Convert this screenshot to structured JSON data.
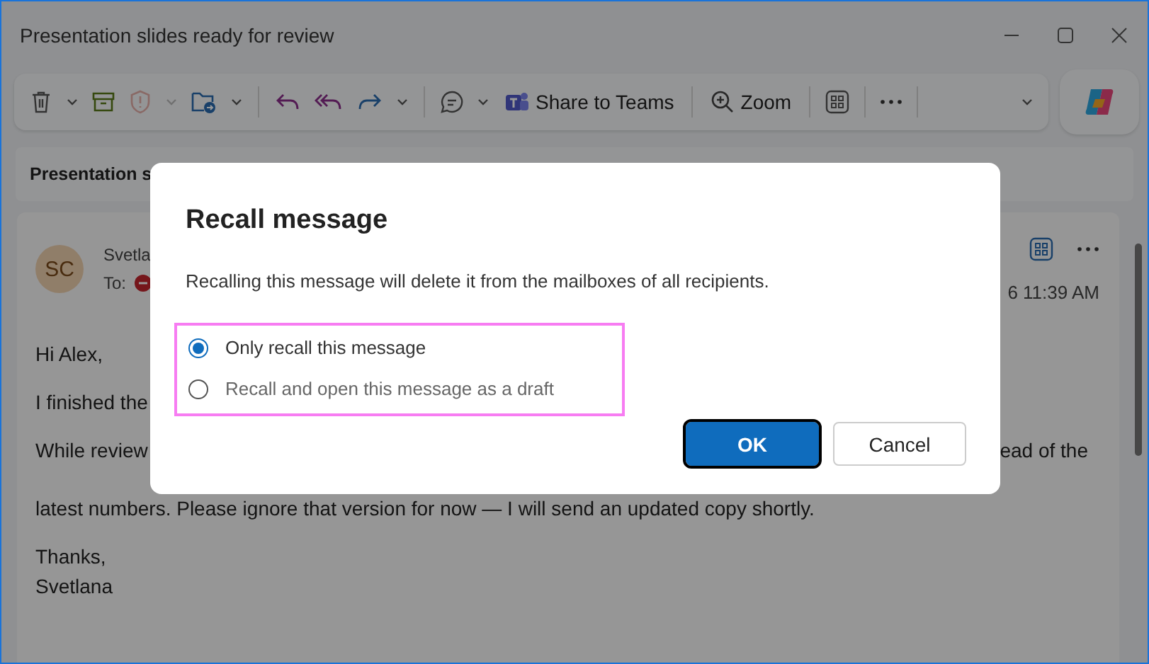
{
  "window": {
    "title": "Presentation slides ready for review"
  },
  "toolbar": {
    "report_disabled": true,
    "buttons": [
      {
        "label": "Share to Teams"
      },
      {
        "label": "Zoom"
      }
    ]
  },
  "subject": "Presentation s",
  "message": {
    "avatar": "SC",
    "sender": "Svetla",
    "to_label": "To:",
    "time": "6 11:39 AM",
    "body": [
      {
        "lines": [
          {
            "left": "Hi Alex,"
          }
        ]
      },
      {
        "lines": [
          {
            "left": "I finished the"
          }
        ]
      },
      {
        "lines": [
          {
            "left": "While review",
            "right": "ead of the"
          },
          {
            "left": "latest numbers. Please ignore that version for now — I will send an updated copy shortly."
          }
        ]
      },
      {
        "lines": [
          {
            "left": "Thanks,"
          },
          {
            "left": "Svetlana"
          }
        ]
      }
    ]
  },
  "dialog": {
    "title": "Recall message",
    "text": "Recalling this message will delete it from the mailboxes of all recipients.",
    "options": [
      {
        "label": "Only recall this message",
        "selected": true
      },
      {
        "label": "Recall and open this message as a draft",
        "selected": false
      }
    ],
    "buttons": [
      {
        "label": "OK",
        "kind": "primary"
      },
      {
        "label": "Cancel",
        "kind": "secondary"
      }
    ]
  }
}
